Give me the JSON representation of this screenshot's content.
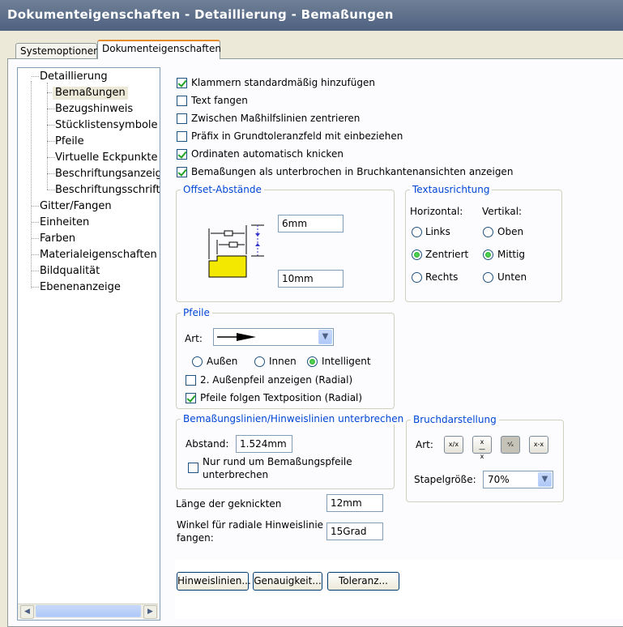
{
  "window": {
    "title": "Dokumenteigenschaften - Detaillierung - Bemaßungen"
  },
  "tabs": [
    {
      "label": "Systemoptionen"
    },
    {
      "label": "Dokumenteigenschaften"
    }
  ],
  "tree": {
    "root": "Detaillierung",
    "children": [
      "Bemaßungen",
      "Bezugshinweis",
      "Stücklistensymbole",
      "Pfeile",
      "Virtuelle Eckpunkte",
      "Beschriftungsanzeige",
      "Beschriftungsschriftart"
    ],
    "top": [
      "Gitter/Fangen",
      "Einheiten",
      "Farben",
      "Materialeigenschaften",
      "Bildqualität",
      "Ebenenanzeige"
    ]
  },
  "checkboxes": [
    {
      "label": "Klammern standardmäßig hinzufügen",
      "checked": true
    },
    {
      "label": "Text fangen",
      "checked": false
    },
    {
      "label": "Zwischen Maßhilfslinien zentrieren",
      "checked": false
    },
    {
      "label": "Präfix in Grundtoleranzfeld mit einbeziehen",
      "checked": false
    },
    {
      "label": "Ordinaten automatisch knicken",
      "checked": true
    },
    {
      "label": "Bemaßungen als unterbrochen in Bruchkantenansichten anzeigen",
      "checked": true
    }
  ],
  "offset": {
    "title": "Offset-Abstände",
    "value1": "6mm",
    "value2": "10mm"
  },
  "text_align": {
    "title": "Textausrichtung",
    "horizontal_label": "Horizontal:",
    "vertical_label": "Vertikal:",
    "h_options": [
      "Links",
      "Zentriert",
      "Rechts"
    ],
    "v_options": [
      "Oben",
      "Mittig",
      "Unten"
    ],
    "h_selected": "Zentriert",
    "v_selected": "Mittig"
  },
  "arrows": {
    "title": "Pfeile",
    "style_label": "Art:",
    "placement": [
      "Außen",
      "Innen",
      "Intelligent"
    ],
    "placement_selected": "Intelligent",
    "second_outside": {
      "label": "2. Außenpfeil anzeigen (Radial)",
      "checked": false
    },
    "follow_text": {
      "label": "Pfeile folgen Textposition (Radial)",
      "checked": true
    }
  },
  "break_lines": {
    "title": "Bemaßungslinien/Hinweislinien unterbrechen",
    "gap_label": "Abstand:",
    "gap_value": "1.524mm",
    "around_arrows": {
      "label_line1": "Nur rund um Bemaßungspfeile",
      "label_line2": "unterbrechen",
      "checked": false
    }
  },
  "fraction": {
    "title": "Bruchdarstellung",
    "style_label": "Art:",
    "style_icons": [
      "x/x",
      "x—x",
      "x/x diagonal",
      "x-x"
    ],
    "style_selected": 2,
    "stack_label": "Stapelgröße:",
    "stack_value": "70%"
  },
  "bent": {
    "label": "Länge der geknickten",
    "value": "12mm"
  },
  "snap": {
    "label_line1": "Winkel für radiale Hinweislinie",
    "label_line2": "fangen:",
    "value": "15Grad"
  },
  "buttons": {
    "leaders": "Hinweislinien...",
    "precision": "Genauigkeit...",
    "tolerance": "Toleranz..."
  }
}
